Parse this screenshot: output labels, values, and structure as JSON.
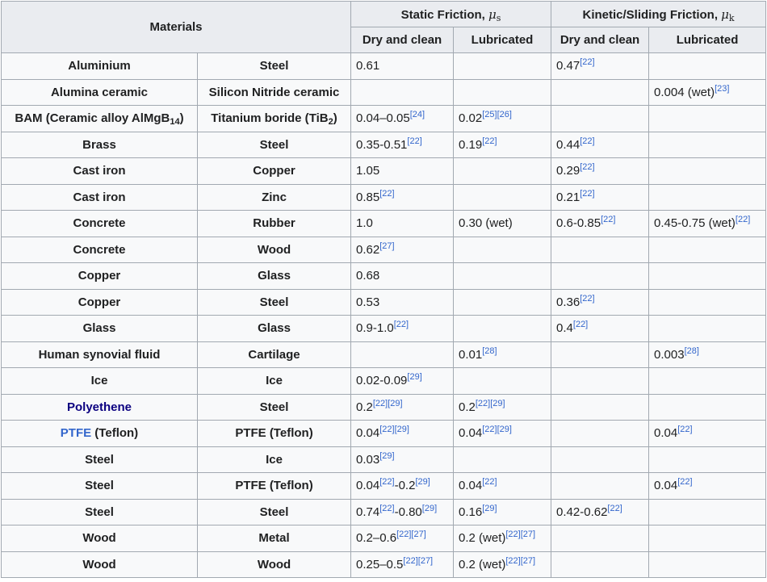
{
  "headers": {
    "materials": "Materials",
    "static": "Static Friction,",
    "kinetic": "Kinetic/Sliding Friction,",
    "mu": "μ",
    "static_sub": "s",
    "kinetic_sub": "k",
    "dry_and_clean": "Dry and clean",
    "lubricated": "Lubricated"
  },
  "rows": [
    {
      "m1": "Aluminium",
      "m2": "Steel",
      "sd": "0.61",
      "sl": "",
      "kd": "0.47[22]",
      "kl": ""
    },
    {
      "m1": "Alumina ceramic",
      "m2": "Silicon Nitride ceramic",
      "sd": "",
      "sl": "",
      "kd": "",
      "kl": "0.004 (wet)[23]"
    },
    {
      "m1": "BAM (Ceramic alloy AlMgB14)",
      "m2": "Titanium boride (TiB2)",
      "sd": "0.04–0.05[24]",
      "sl": "0.02[25][26]",
      "kd": "",
      "kl": ""
    },
    {
      "m1": "Brass",
      "m2": "Steel",
      "sd": "0.35-0.51[22]",
      "sl": "0.19[22]",
      "kd": "0.44[22]",
      "kl": ""
    },
    {
      "m1": "Cast iron",
      "m2": "Copper",
      "sd": "1.05",
      "sl": "",
      "kd": "0.29[22]",
      "kl": ""
    },
    {
      "m1": "Cast iron",
      "m2": "Zinc",
      "sd": "0.85[22]",
      "sl": "",
      "kd": "0.21[22]",
      "kl": ""
    },
    {
      "m1": "Concrete",
      "m2": "Rubber",
      "sd": "1.0",
      "sl": "0.30 (wet)",
      "kd": "0.6-0.85[22]",
      "kl": "0.45-0.75 (wet)[22]"
    },
    {
      "m1": "Concrete",
      "m2": "Wood",
      "sd": "0.62[27]",
      "sl": "",
      "kd": "",
      "kl": ""
    },
    {
      "m1": "Copper",
      "m2": "Glass",
      "sd": "0.68",
      "sl": "",
      "kd": "",
      "kl": ""
    },
    {
      "m1": "Copper",
      "m2": "Steel",
      "sd": "0.53",
      "sl": "",
      "kd": "0.36[22]",
      "kl": ""
    },
    {
      "m1": "Glass",
      "m2": "Glass",
      "sd": "0.9-1.0[22]",
      "sl": "",
      "kd": "0.4[22]",
      "kl": ""
    },
    {
      "m1": "Human synovial fluid",
      "m2": "Cartilage",
      "sd": "",
      "sl": "0.01[28]",
      "kd": "",
      "kl": "0.003[28]"
    },
    {
      "m1": "Ice",
      "m2": "Ice",
      "sd": "0.02-0.09[29]",
      "sl": "",
      "kd": "",
      "kl": ""
    },
    {
      "m1": "Polyethene",
      "m2": "Steel",
      "sd": "0.2[22][29]",
      "sl": "0.2[22][29]",
      "kd": "",
      "kl": ""
    },
    {
      "m1": "PTFE",
      "m1_extra": " (Teflon)",
      "m2": "PTFE (Teflon)",
      "sd": "0.04[22][29]",
      "sl": "0.04[22][29]",
      "kd": "",
      "kl": "0.04[22]"
    },
    {
      "m1": "Steel",
      "m2": "Ice",
      "sd": "0.03[29]",
      "sl": "",
      "kd": "",
      "kl": ""
    },
    {
      "m1": "Steel",
      "m2": "PTFE (Teflon)",
      "sd": "0.04[22]-0.2[29]",
      "sl": "0.04[22]",
      "kd": "",
      "kl": "0.04[22]"
    },
    {
      "m1": "Steel",
      "m2": "Steel",
      "sd": "0.74[22]-0.80[29]",
      "sl": "0.16[29]",
      "kd": "0.42-0.62[22]",
      "kl": ""
    },
    {
      "m1": "Wood",
      "m2": "Metal",
      "sd": "0.2–0.6[22][27]",
      "sl": "0.2 (wet)[22][27]",
      "kd": "",
      "kl": ""
    },
    {
      "m1": "Wood",
      "m2": "Wood",
      "sd": "0.25–0.5[22][27]",
      "sl": "0.2 (wet)[22][27]",
      "kd": "",
      "kl": ""
    }
  ],
  "colors": {
    "header_bg": "#eaecf0",
    "cell_bg": "#f8f9fa",
    "border": "#a2a9b1",
    "link": "#3366cc",
    "visited_link": "#0b0080"
  }
}
